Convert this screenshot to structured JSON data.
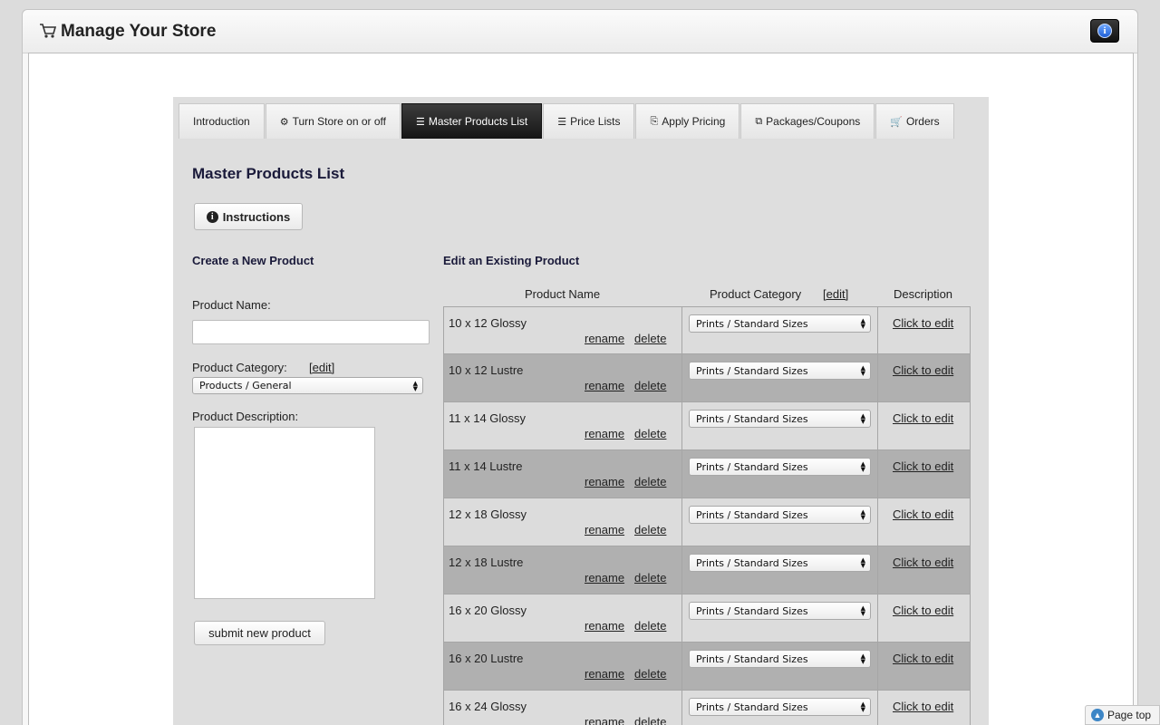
{
  "header": {
    "title": "Manage Your Store",
    "info_icon": "info-icon"
  },
  "tabs": [
    {
      "label": "Introduction",
      "icon": ""
    },
    {
      "label": "Turn Store on or off",
      "icon": "⚙"
    },
    {
      "label": "Master Products List",
      "icon": "☰",
      "active": true
    },
    {
      "label": "Price Lists",
      "icon": "☰"
    },
    {
      "label": "Apply Pricing",
      "icon": "⎘"
    },
    {
      "label": "Packages/Coupons",
      "icon": "⧉"
    },
    {
      "label": "Orders",
      "icon": "🛒"
    }
  ],
  "main": {
    "title": "Master Products List",
    "instructions_label": "Instructions"
  },
  "create": {
    "title": "Create a New Product",
    "name_label": "Product Name:",
    "name_value": "",
    "category_label": "Product Category:",
    "category_edit": "[edit]",
    "category_value": "Products / General",
    "description_label": "Product Description:",
    "description_value": "",
    "submit_label": "submit new product"
  },
  "edit": {
    "title": "Edit an Existing Product",
    "headers": {
      "name": "Product Name",
      "category": "Product Category",
      "category_edit": "[edit]",
      "description": "Description"
    },
    "rename_label": "rename",
    "delete_label": "delete",
    "desc_link": "Click to edit",
    "rows": [
      {
        "name": "10 x 12 Glossy",
        "category": "Prints / Standard Sizes"
      },
      {
        "name": "10 x 12 Lustre",
        "category": "Prints / Standard Sizes"
      },
      {
        "name": "11 x 14 Glossy",
        "category": "Prints / Standard Sizes"
      },
      {
        "name": "11 x 14 Lustre",
        "category": "Prints / Standard Sizes"
      },
      {
        "name": "12 x 18 Glossy",
        "category": "Prints / Standard Sizes"
      },
      {
        "name": "12 x 18 Lustre",
        "category": "Prints / Standard Sizes"
      },
      {
        "name": "16 x 20 Glossy",
        "category": "Prints / Standard Sizes"
      },
      {
        "name": "16 x 20 Lustre",
        "category": "Prints / Standard Sizes"
      },
      {
        "name": "16 x 24 Glossy",
        "category": "Prints / Standard Sizes"
      }
    ]
  },
  "footer": {
    "page_top_label": "Page top"
  },
  "colors": {
    "active_tab": "#1f1f1f",
    "row_alt": "#b0b0b0",
    "row": "#dcdcdc",
    "panel": "#dedede"
  }
}
